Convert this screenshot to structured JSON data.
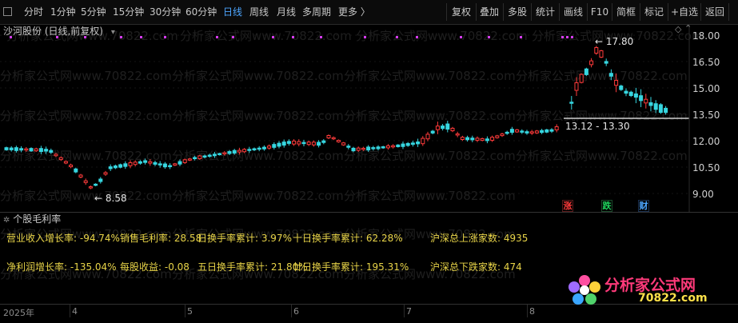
{
  "toolbar": {
    "left_tabs": [
      "分时",
      "1分钟",
      "5分钟",
      "15分钟",
      "30分钟",
      "60分钟",
      "日线",
      "周线",
      "月线",
      "多周期",
      "更多 〉"
    ],
    "active_tab": "日线",
    "right_buttons": [
      "复权",
      "叠加",
      "多股",
      "统计",
      "画线",
      "F10",
      "简框",
      "标记",
      "+自选",
      "返回"
    ]
  },
  "stock": {
    "name_line": "沙河股份 (日线,前复权)"
  },
  "price_axis": [
    "18.00",
    "16.50",
    "15.00",
    "13.50",
    "12.00",
    "10.50",
    "9.00"
  ],
  "annotations": {
    "high": "17.80",
    "low": "8.58",
    "range": "13.12 - 13.30"
  },
  "badges": {
    "rise": "涨",
    "fall": "跌",
    "finance": "财"
  },
  "indicator": {
    "title": "个股毛利率",
    "stats": [
      {
        "text": "营业收入增长率: -94.74%"
      },
      {
        "text": "销售毛利率: 28.58"
      },
      {
        "text": "日换手率累计: 3.97%"
      },
      {
        "text": "十日换手率累计: 62.28%"
      },
      {
        "text": "沪深总上涨家数: 4935"
      },
      {
        "text": "净利润增长率: -135.04%"
      },
      {
        "text": "每股收益: -0.08"
      },
      {
        "text": "五日换手率累计: 21.80%"
      },
      {
        "text": "廿日换手率累计: 195.31%"
      },
      {
        "text": "沪深总下跌家数: 474"
      }
    ]
  },
  "xaxis": [
    "2025年",
    "4",
    "5",
    "6",
    "7",
    "8"
  ],
  "watermark": "分析家公式网www.70822.com",
  "logo": {
    "line1": "分析家公式网",
    "line2": "70822.com"
  },
  "colors": {
    "up": "#ff3b3b",
    "down": "#36d6e0",
    "active": "#4da6ff",
    "stat": "#e8d448"
  }
}
